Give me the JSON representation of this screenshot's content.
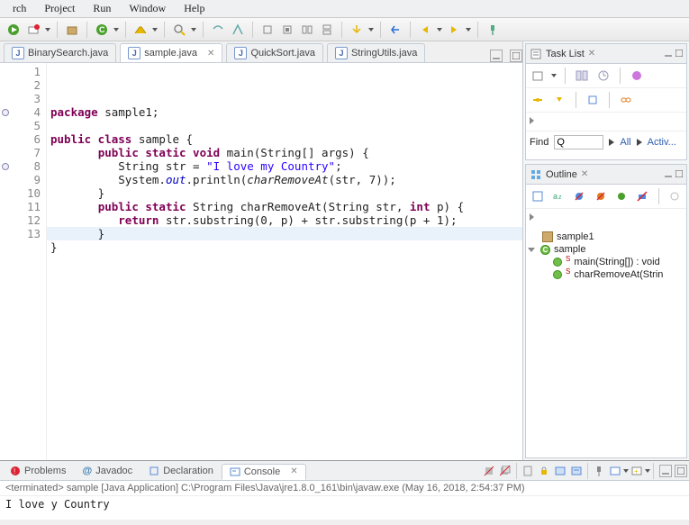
{
  "menu": {
    "items": [
      "rch",
      "Project",
      "Run",
      "Window",
      "Help"
    ]
  },
  "editor": {
    "tabs": [
      {
        "label": "BinarySearch.java"
      },
      {
        "label": "sample.java",
        "active": true
      },
      {
        "label": "QuickSort.java"
      },
      {
        "label": "StringUtils.java"
      }
    ],
    "lines": [
      "1",
      "2",
      "3",
      "4",
      "5",
      "6",
      "7",
      "8",
      "9",
      "10",
      "11",
      "12",
      "13"
    ],
    "code_html": "<span class='kw'>package</span> sample1;\n\n<span class='kw'>public class</span> sample {\n       <span class='kw'>public static void</span> main(String[] args) {\n          String str = <span class='st'>\"I love my Country\"</span>;\n          System.<span class='field'>out</span>.println(<span class='fn'>charRemoveAt</span>(str, 7));\n       }\n       <span class='kw'>public static</span> String charRemoveAt(String str, <span class='kw'>int</span> p) {\n          <span class='kw'>return</span> str.substring(0, p) + str.substring(p + 1);\n       }\n}\n\n"
  },
  "tasklist": {
    "title": "Task List",
    "find_label": "Find",
    "find_query": "Q",
    "all_link": "All",
    "activate_link": "Activ..."
  },
  "outline": {
    "title": "Outline",
    "package": "sample1",
    "class": "sample",
    "methods": [
      "main(String[]) : void",
      "charRemoveAt(Strin"
    ]
  },
  "bottom": {
    "tabs": [
      "Problems",
      "Javadoc",
      "Declaration",
      "Console"
    ],
    "active": 3,
    "term_line": "<terminated> sample [Java Application] C:\\Program Files\\Java\\jre1.8.0_161\\bin\\javaw.exe (May 16, 2018, 2:54:37 PM)",
    "output": "I love y Country"
  }
}
